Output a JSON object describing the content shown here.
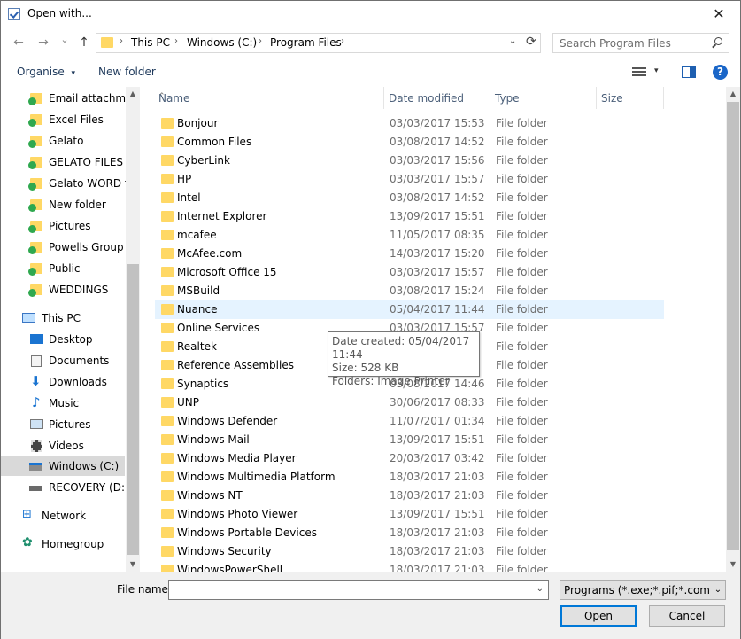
{
  "window": {
    "title": "Open with...",
    "close_glyph": "✕"
  },
  "address": {
    "back_glyph": "←",
    "forward_glyph": "→",
    "recent_glyph": "⌄",
    "up_glyph": "↑",
    "crumbs": [
      "This PC",
      "Windows (C:)",
      "Program Files"
    ],
    "sep": "›",
    "drop_glyph": "⌄",
    "refresh_glyph": "⟳"
  },
  "search": {
    "placeholder": "Search Program Files"
  },
  "toolbar": {
    "organise": "Organise",
    "organise_caret": "▾",
    "new_folder": "New folder",
    "view_caret": "▾",
    "help": "?"
  },
  "nav": {
    "items": [
      {
        "label": "Email attachmer",
        "icon": "folder-synced-icon"
      },
      {
        "label": "Excel Files",
        "icon": "folder-synced-icon"
      },
      {
        "label": "Gelato",
        "icon": "folder-synced-icon"
      },
      {
        "label": "GELATO FILES",
        "icon": "folder-synced-icon"
      },
      {
        "label": "Gelato WORD fil",
        "icon": "folder-synced-icon"
      },
      {
        "label": "New folder",
        "icon": "folder-synced-icon"
      },
      {
        "label": "Pictures",
        "icon": "folder-synced-icon"
      },
      {
        "label": "Powells Group",
        "icon": "folder-synced-icon"
      },
      {
        "label": "Public",
        "icon": "folder-synced-icon"
      },
      {
        "label": "WEDDINGS",
        "icon": "folder-synced-icon"
      },
      {
        "label": "This PC",
        "icon": "computer-icon"
      },
      {
        "label": "Desktop",
        "icon": "desktop-icon"
      },
      {
        "label": "Documents",
        "icon": "documents-icon"
      },
      {
        "label": "Downloads",
        "icon": "downloads-icon"
      },
      {
        "label": "Music",
        "icon": "music-icon"
      },
      {
        "label": "Pictures",
        "icon": "pictures-icon"
      },
      {
        "label": "Videos",
        "icon": "videos-icon"
      },
      {
        "label": "Windows (C:)",
        "icon": "drive-windows-icon"
      },
      {
        "label": "RECOVERY (D:)",
        "icon": "drive-icon"
      },
      {
        "label": "Network",
        "icon": "network-icon"
      },
      {
        "label": "Homegroup",
        "icon": "homegroup-icon"
      }
    ],
    "selected": "Windows (C:)"
  },
  "columns": {
    "name": "Name",
    "date": "Date modified",
    "type": "Type",
    "size": "Size",
    "sort_glyph": "⌃"
  },
  "files": [
    {
      "name": "Bonjour",
      "date": "03/03/2017 15:53",
      "type": "File folder"
    },
    {
      "name": "Common Files",
      "date": "03/08/2017 14:52",
      "type": "File folder"
    },
    {
      "name": "CyberLink",
      "date": "03/03/2017 15:56",
      "type": "File folder"
    },
    {
      "name": "HP",
      "date": "03/03/2017 15:57",
      "type": "File folder"
    },
    {
      "name": "Intel",
      "date": "03/08/2017 14:52",
      "type": "File folder"
    },
    {
      "name": "Internet Explorer",
      "date": "13/09/2017 15:51",
      "type": "File folder"
    },
    {
      "name": "mcafee",
      "date": "11/05/2017 08:35",
      "type": "File folder"
    },
    {
      "name": "McAfee.com",
      "date": "14/03/2017 15:20",
      "type": "File folder"
    },
    {
      "name": "Microsoft Office 15",
      "date": "03/03/2017 15:57",
      "type": "File folder"
    },
    {
      "name": "MSBuild",
      "date": "03/08/2017 15:24",
      "type": "File folder"
    },
    {
      "name": "Nuance",
      "date": "05/04/2017 11:44",
      "type": "File folder"
    },
    {
      "name": "Online Services",
      "date": "03/03/2017 15:57",
      "type": "File folder"
    },
    {
      "name": "Realtek",
      "date": "",
      "type": "File folder"
    },
    {
      "name": "Reference Assemblies",
      "date": "",
      "type": "File folder"
    },
    {
      "name": "Synaptics",
      "date": "03/08/2017 14:46",
      "type": "File folder"
    },
    {
      "name": "UNP",
      "date": "30/06/2017 08:33",
      "type": "File folder"
    },
    {
      "name": "Windows Defender",
      "date": "11/07/2017 01:34",
      "type": "File folder"
    },
    {
      "name": "Windows Mail",
      "date": "13/09/2017 15:51",
      "type": "File folder"
    },
    {
      "name": "Windows Media Player",
      "date": "20/03/2017 03:42",
      "type": "File folder"
    },
    {
      "name": "Windows Multimedia Platform",
      "date": "18/03/2017 21:03",
      "type": "File folder"
    },
    {
      "name": "Windows NT",
      "date": "18/03/2017 21:03",
      "type": "File folder"
    },
    {
      "name": "Windows Photo Viewer",
      "date": "13/09/2017 15:51",
      "type": "File folder"
    },
    {
      "name": "Windows Portable Devices",
      "date": "18/03/2017 21:03",
      "type": "File folder"
    },
    {
      "name": "Windows Security",
      "date": "18/03/2017 21:03",
      "type": "File folder"
    },
    {
      "name": "WindowsPowerShell",
      "date": "18/03/2017 21:03",
      "type": "File folder"
    }
  ],
  "hovered_file": "Nuance",
  "tooltip": {
    "line1": "Date created: 05/04/2017 11:44",
    "line2": "Size: 528 KB",
    "line3": "Folders: Image Printer"
  },
  "bottom": {
    "filename_label": "File name:",
    "filename_value": "",
    "filter": "Programs (*.exe;*.pif;*.com;*.bat;*.cmd)",
    "filter_caret": "⌄",
    "open": "Open",
    "cancel": "Cancel"
  },
  "scroll": {
    "up_glyph": "▲",
    "down_glyph": "▼"
  }
}
